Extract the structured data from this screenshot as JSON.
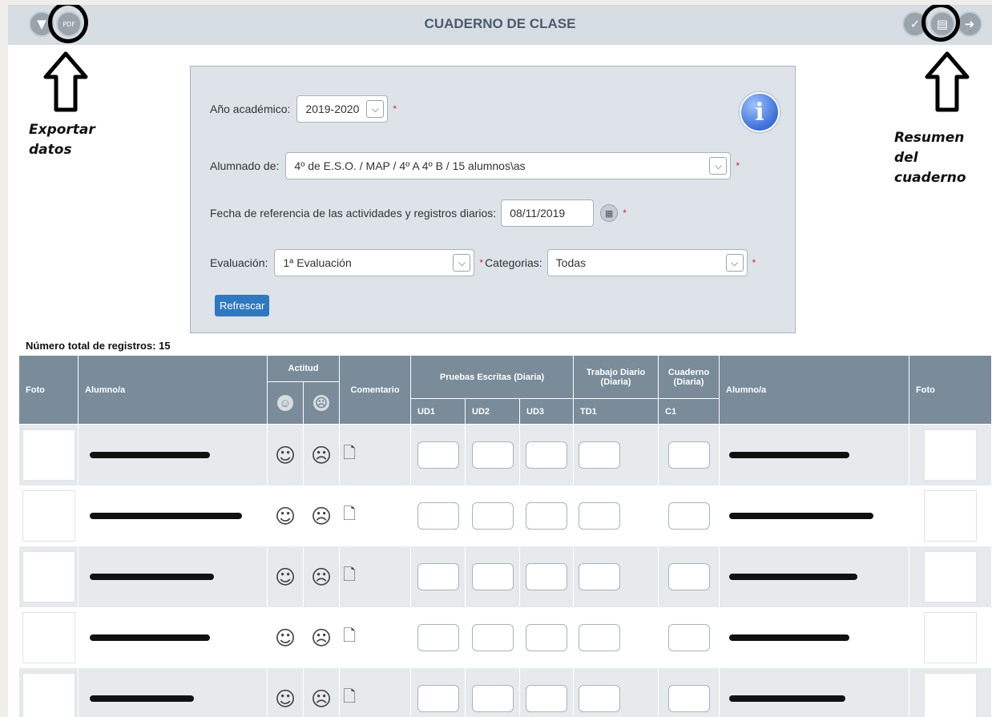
{
  "header": {
    "title": "CUADERNO DE CLASE",
    "left_icons": [
      "filter-icon",
      "export-pdf-xls-icon"
    ],
    "right_icons": [
      "check-icon",
      "summary-icon",
      "exit-icon"
    ]
  },
  "annotations": {
    "left": [
      "Exportar",
      "datos"
    ],
    "right": [
      "Resumen",
      "del",
      "cuaderno"
    ]
  },
  "filters": {
    "year_label": "Año académico:",
    "year_value": "2019-2020",
    "students_label": "Alumnado de:",
    "students_value": "4º de E.S.O. / MAP / 4º A 4º B / 15 alumnos\\as",
    "date_label": "Fecha de referencia de las actividades y registros diarios:",
    "date_value": "08/11/2019",
    "eval_label": "Evaluación:",
    "eval_value": "1ª Evaluación",
    "cat_label": "Categorias:",
    "cat_value": "Todas",
    "required_mark": "*",
    "refresh_label": "Refrescar",
    "info_glyph": "i"
  },
  "total_records": "Número total de registros: 15",
  "table": {
    "headers": {
      "foto": "Foto",
      "alumno": "Alumno/a",
      "actitud": "Actitud",
      "comentario": "Comentario",
      "pruebas": "Pruebas Escritas (Diaria)",
      "ud1": "UD1",
      "ud2": "UD2",
      "ud3": "UD3",
      "trabajo": "Trabajo Diario (Diaria)",
      "td1": "TD1",
      "cuaderno": "Cuaderno (Diaria)",
      "c1": "C1",
      "alumno2": "Alumno/a",
      "foto2": "Foto"
    },
    "row_count_visible": 5
  }
}
